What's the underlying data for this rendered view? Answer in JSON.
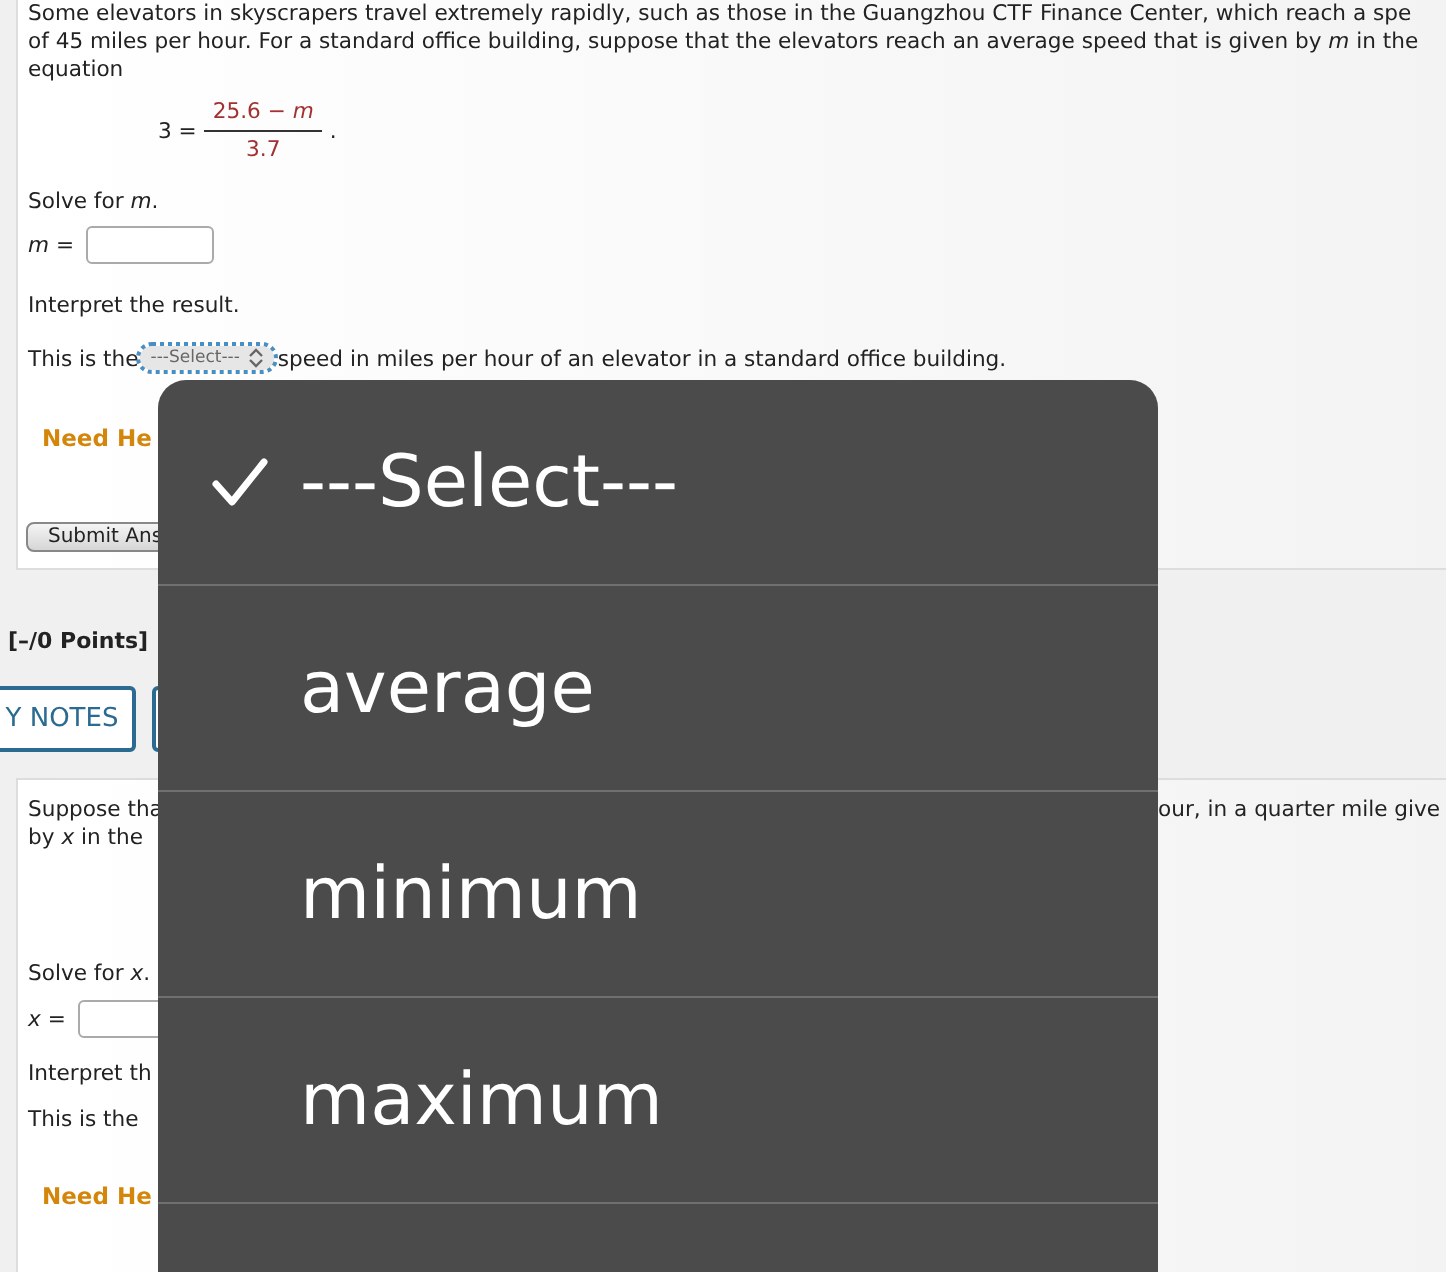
{
  "question1": {
    "paragraph": [
      "Some elevators in skyscrapers travel extremely rapidly, such as those in the Guangzhou CTF Finance Center, which reach a spe",
      "of 45 miles per hour. For a standard office building, suppose that the elevators reach an average speed that is given by *m* in the",
      "equation"
    ],
    "equation": {
      "lhs": "3 =",
      "numerator": "25.6 − *m*",
      "denominator": "3.7",
      "end": "."
    },
    "solve_prompt": "Solve for *m*.",
    "answer_label": "*m* =",
    "interpret_prompt": "Interpret the result.",
    "sentence_start": "This is the",
    "select_value": "---Select---",
    "sentence_end": "speed in miles per hour of an elevator in a standard office building.",
    "help": "Need He",
    "submit": "Submit Ans"
  },
  "points": "[–/0 Points]",
  "notes_button": "Y NOTES",
  "question2": {
    "paragraph": [
      "Suppose tha",
      "by *x* in the"
    ],
    "paragraph_right": "our, in a quarter mile give",
    "solve_prompt": "Solve for *x*.",
    "answer_label": "*x* =",
    "interpret_prompt": "Interpret th",
    "sentence_start": "This is the",
    "help": "Need He"
  },
  "dropdown": {
    "options": [
      {
        "label": "---Select---",
        "selected": true
      },
      {
        "label": "average",
        "selected": false
      },
      {
        "label": "minimum",
        "selected": false
      },
      {
        "label": "maximum",
        "selected": false
      }
    ]
  }
}
